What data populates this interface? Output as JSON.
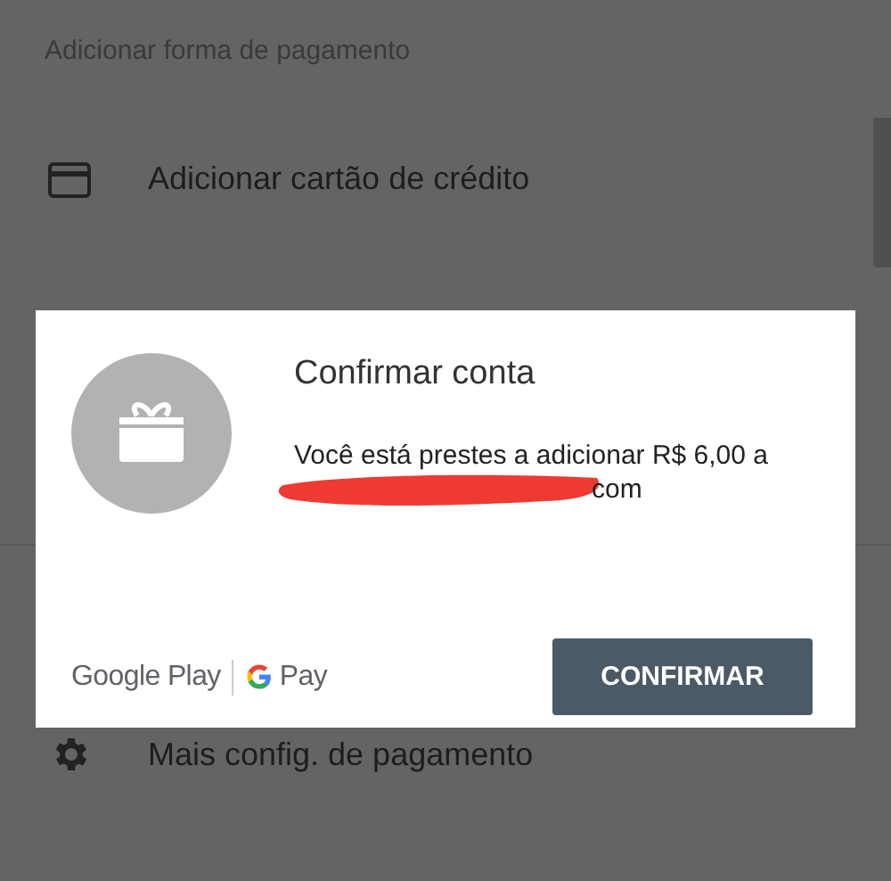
{
  "section_title": "Adicionar forma de pagamento",
  "menu_items": [
    {
      "kind": "card",
      "label": "Adicionar cartão de crédito"
    },
    {
      "kind": "gear",
      "label": "Mais config. de pagamento"
    }
  ],
  "dialog": {
    "title": "Confirmar conta",
    "message": "Você está prestes a adicionar R$ 6,00 a",
    "email_visible_end": "com",
    "brand_left": "Google Play",
    "brand_right": "Pay",
    "button": "CONFIRMAR"
  }
}
